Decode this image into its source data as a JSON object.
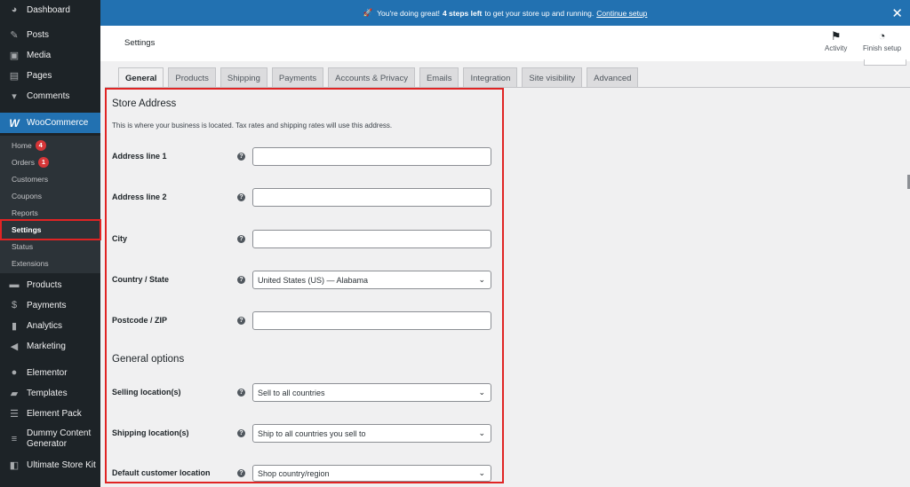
{
  "notice": {
    "text_before": "You're doing great!",
    "bold": "4 steps left",
    "text_after": "to get your store up and running.",
    "link": "Continue setup",
    "close_icon": "close-icon"
  },
  "sidebar": {
    "items": [
      {
        "label": "Dashboard",
        "icon": "dashboard-icon"
      },
      {
        "label": "Posts",
        "icon": "pin-icon"
      },
      {
        "label": "Media",
        "icon": "media-icon"
      },
      {
        "label": "Pages",
        "icon": "pages-icon"
      },
      {
        "label": "Comments",
        "icon": "comments-icon"
      },
      {
        "label": "WooCommerce",
        "icon": "woocommerce-icon"
      },
      {
        "label": "Products",
        "icon": "products-icon"
      },
      {
        "label": "Payments",
        "icon": "payments-icon"
      },
      {
        "label": "Analytics",
        "icon": "analytics-icon"
      },
      {
        "label": "Marketing",
        "icon": "megaphone-icon"
      },
      {
        "label": "Elementor",
        "icon": "elementor-icon"
      },
      {
        "label": "Templates",
        "icon": "folder-icon"
      },
      {
        "label": "Element Pack",
        "icon": "element-pack-icon"
      },
      {
        "label": "Dummy Content Generator",
        "icon": "database-icon"
      },
      {
        "label": "Ultimate Store Kit",
        "icon": "bag-icon"
      }
    ],
    "submenu": [
      {
        "label": "Home",
        "badge": "4"
      },
      {
        "label": "Orders",
        "badge": "1"
      },
      {
        "label": "Customers"
      },
      {
        "label": "Coupons"
      },
      {
        "label": "Reports"
      },
      {
        "label": "Settings"
      },
      {
        "label": "Status"
      },
      {
        "label": "Extensions"
      }
    ]
  },
  "header": {
    "title": "Settings",
    "activity": "Activity",
    "finish_setup": "Finish setup"
  },
  "tabs": [
    "General",
    "Products",
    "Shipping",
    "Payments",
    "Accounts & Privacy",
    "Emails",
    "Integration",
    "Site visibility",
    "Advanced"
  ],
  "store_address": {
    "heading": "Store Address",
    "description": "This is where your business is located. Tax rates and shipping rates will use this address.",
    "fields": [
      {
        "label": "Address line 1",
        "value": ""
      },
      {
        "label": "Address line 2",
        "value": ""
      },
      {
        "label": "City",
        "value": ""
      },
      {
        "label": "Country / State",
        "value": "United States (US) — Alabama"
      },
      {
        "label": "Postcode / ZIP",
        "value": ""
      }
    ]
  },
  "general_options": {
    "heading": "General options",
    "fields": [
      {
        "label": "Selling location(s)",
        "value": "Sell to all countries"
      },
      {
        "label": "Shipping location(s)",
        "value": "Ship to all countries you sell to"
      },
      {
        "label": "Default customer location",
        "value": "Shop country/region"
      }
    ]
  },
  "colors": {
    "sidebar_bg": "#1d2327",
    "accent": "#2271b1",
    "badge": "#d63638",
    "highlight": "#e02424"
  }
}
